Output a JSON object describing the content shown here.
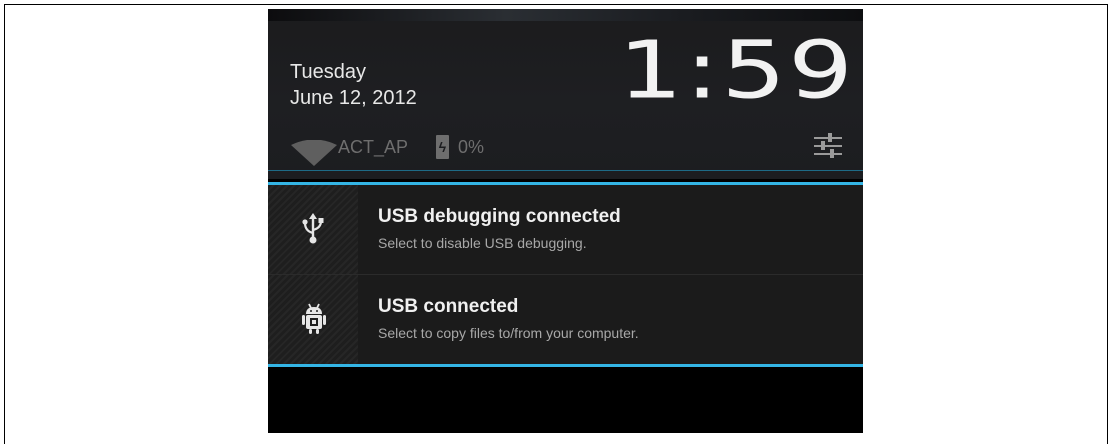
{
  "status_header": {
    "day": "Tuesday",
    "date": "June 12, 2012",
    "time": "1:59",
    "network_name": "ACT_AP",
    "battery_percent": "0%",
    "wifi_icon": "wifi-icon",
    "battery_icon": "battery-charging-icon",
    "settings_icon": "quick-settings-icon"
  },
  "notifications": [
    {
      "icon": "usb-icon",
      "title": "USB debugging connected",
      "subtitle": "Select to disable USB debugging."
    },
    {
      "icon": "android-usb-icon",
      "title": "USB connected",
      "subtitle": "Select to copy files to/from your computer."
    }
  ],
  "colors": {
    "accent": "#34b5e5",
    "background": "#000000",
    "panel": "#1b1b1b"
  }
}
